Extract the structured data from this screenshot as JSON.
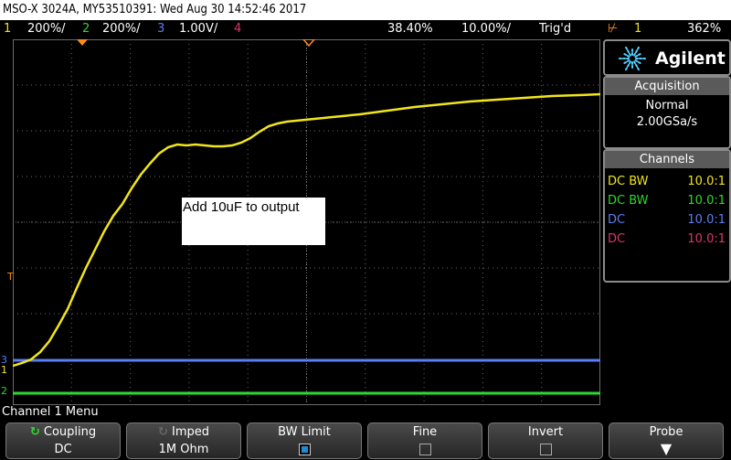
{
  "titlebar": {
    "text": "MSO-X 3024A, MY53510391: Wed Aug 30 14:52:46 2017"
  },
  "status": {
    "ch1_num": "1",
    "ch1_scale": "200%/",
    "ch2_num": "2",
    "ch2_scale": "200%/",
    "ch3_num": "3",
    "ch3_scale": "1.00V/",
    "ch4_num": "4",
    "delay": "38.40%",
    "timebase": "10.00%/",
    "trig_state": "Trig'd",
    "trig_ch": "1",
    "trig_level": "362%"
  },
  "colors": {
    "ch1": "#f2e51a",
    "ch2": "#2fd82f",
    "ch3": "#5a7ef5",
    "ch4": "#e0346a",
    "trigger_marker": "#ff8c1a",
    "grid": "#6a6a6a"
  },
  "markers": {
    "trigger": "T",
    "ch3": "3",
    "ch1": "1",
    "ch2": "2"
  },
  "annotation": {
    "text": "Add 10uF to output"
  },
  "panel": {
    "brand": "Agilent",
    "brand_icon": "starburst-icon",
    "acquisition": {
      "heading": "Acquisition",
      "mode": "Normal",
      "rate": "2.00GSa/s"
    },
    "channels": {
      "heading": "Channels",
      "rows": [
        {
          "coupling": "DC BW",
          "probe": "10.0:1",
          "color": "#f2e51a"
        },
        {
          "coupling": "DC BW",
          "probe": "10.0:1",
          "color": "#2fd82f"
        },
        {
          "coupling": "DC",
          "probe": "10.0:1",
          "color": "#5a7ef5"
        },
        {
          "coupling": "DC",
          "probe": "10.0:1",
          "color": "#e0346a"
        }
      ]
    }
  },
  "menu": {
    "title": "Channel 1 Menu",
    "softkeys": [
      {
        "label": "Coupling",
        "value": "DC"
      },
      {
        "label": "Imped",
        "value": "1M Ohm"
      },
      {
        "label": "BW Limit",
        "checked": true
      },
      {
        "label": "Fine",
        "checked": false
      },
      {
        "label": "Invert",
        "checked": false
      },
      {
        "label": "Probe"
      }
    ]
  }
}
